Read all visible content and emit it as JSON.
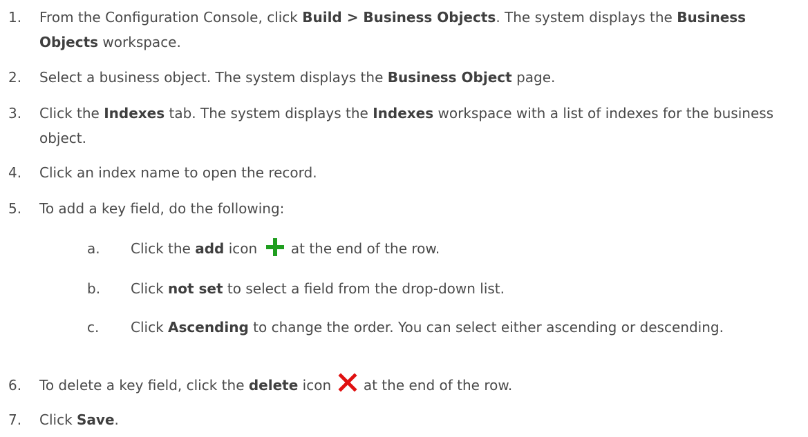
{
  "steps": [
    {
      "num": "1.",
      "parts": [
        {
          "t": "From the Configuration Console, click ",
          "b": false
        },
        {
          "t": "Build > Business Objects",
          "b": true
        },
        {
          "t": ". The system displays the ",
          "b": false
        },
        {
          "t": "Business Objects",
          "b": true
        },
        {
          "t": " workspace.",
          "b": false
        }
      ]
    },
    {
      "num": "2.",
      "parts": [
        {
          "t": "Select a business object. The system displays the ",
          "b": false
        },
        {
          "t": "Business Object",
          "b": true
        },
        {
          "t": " page.",
          "b": false
        }
      ]
    },
    {
      "num": "3.",
      "parts": [
        {
          "t": "Click the ",
          "b": false
        },
        {
          "t": "Indexes",
          "b": true
        },
        {
          "t": " tab. The system displays the ",
          "b": false
        },
        {
          "t": "Indexes",
          "b": true
        },
        {
          "t": " workspace with a list of indexes for the business object.",
          "b": false
        }
      ]
    },
    {
      "num": "4.",
      "parts": [
        {
          "t": "Click an index name to open the record.",
          "b": false
        }
      ]
    },
    {
      "num": "5.",
      "parts": [
        {
          "t": "To add a key field, do the following:",
          "b": false
        }
      ]
    },
    {
      "num": "6.",
      "parts": [
        {
          "t": "To delete a key field, click the ",
          "b": false
        },
        {
          "t": "delete",
          "b": true
        },
        {
          "t": " icon ",
          "b": false
        },
        {
          "icon": "delete-icon"
        },
        {
          "t": " at the end of the row.",
          "b": false
        }
      ]
    },
    {
      "num": "7.",
      "parts": [
        {
          "t": "Click ",
          "b": false
        },
        {
          "t": "Save",
          "b": true
        },
        {
          "t": ".",
          "b": false
        }
      ]
    }
  ],
  "substeps": [
    {
      "num": "a.",
      "parts": [
        {
          "t": "Click the ",
          "b": false
        },
        {
          "t": "add",
          "b": true
        },
        {
          "t": " icon ",
          "b": false
        },
        {
          "icon": "add-icon"
        },
        {
          "t": " at the end of the row.",
          "b": false
        }
      ]
    },
    {
      "num": "b.",
      "parts": [
        {
          "t": "Click ",
          "b": false
        },
        {
          "t": "not set",
          "b": true
        },
        {
          "t": " to select a field from the drop-down list.",
          "b": false
        }
      ]
    },
    {
      "num": "c.",
      "parts": [
        {
          "t": "Click ",
          "b": false
        },
        {
          "t": "Ascending",
          "b": true
        },
        {
          "t": " to change the order. You can select either ascending or descending.",
          "b": false
        }
      ]
    }
  ],
  "colors": {
    "text": "#4a4a4a",
    "add_icon": "#1f9e1f",
    "delete_icon": "#e01010"
  }
}
